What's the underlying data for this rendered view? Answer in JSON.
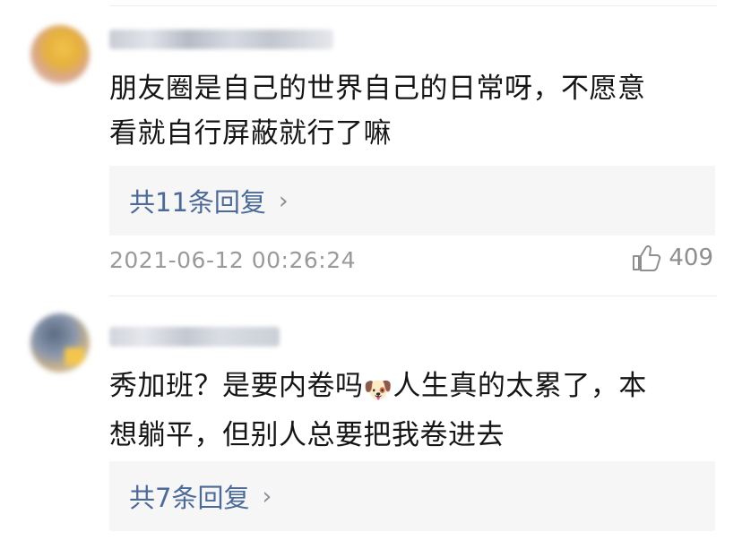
{
  "comments": [
    {
      "text_line1": "朋友圈是自己的世界自己的日常呀，不愿意",
      "text_line2": "看就自行屏蔽就行了嘛",
      "replies_label": "共11条回复",
      "timestamp": "2021-06-12 00:26:24",
      "likes": "409"
    },
    {
      "text_line1_a": "秀加班？是要内卷吗",
      "emoji": "🐶",
      "text_line1_b": "人生真的太累了，本",
      "text_line2": "想躺平，但别人总要把我卷进去",
      "replies_label": "共7条回复"
    }
  ],
  "icons": {
    "chevron": "chevron-right-icon",
    "like": "thumbs-up-icon"
  }
}
